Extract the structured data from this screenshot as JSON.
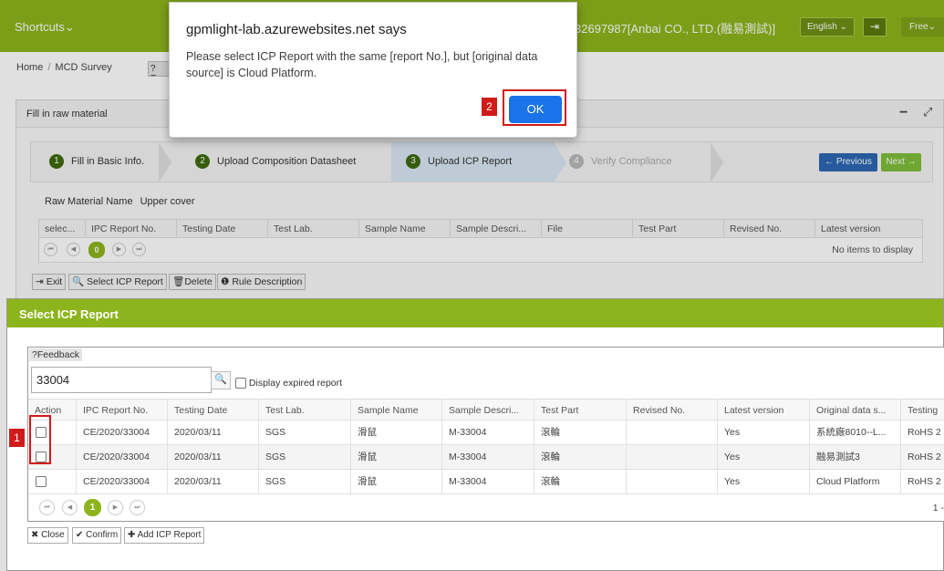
{
  "topbar": {
    "shortcuts": "Shortcuts",
    "shortcuts_chevron": "⌄",
    "company": "32697987[Anbai CO., LTD.(融易測試)]",
    "language": "English ⌄",
    "logout_icon": "⇥",
    "free": "Free⌄"
  },
  "breadcrumb": {
    "home": "Home",
    "sep": "/",
    "current": "MCD Survey",
    "feedback": "?Feedback"
  },
  "panel": {
    "title": "Fill in raw material",
    "minimize": "−",
    "expand": "⤢",
    "steps": [
      {
        "num": "1",
        "label": "Fill in Basic Info."
      },
      {
        "num": "2",
        "label": "Upload Composition Datasheet"
      },
      {
        "num": "3",
        "label": "Upload ICP Report"
      },
      {
        "num": "4",
        "label": "Verify Compliance"
      }
    ],
    "previous": "← Previous",
    "next": "Next →",
    "raw_material_label": "Raw Material Name",
    "raw_material_value": "Upper cover",
    "columns": [
      "selec...",
      "IPC Report No.",
      "Testing Date",
      "Test Lab.",
      "Sample Name",
      "Sample Descri...",
      "File",
      "Test Part",
      "Revised No.",
      "Latest version"
    ],
    "pager": {
      "first": "⏮",
      "prev": "◀",
      "page": "0",
      "next": "▶",
      "last": "⏭"
    },
    "no_items": "No items to display",
    "toolbar": {
      "exit": "⇥ Exit",
      "select": "🔍 Select ICP Report",
      "delete": "🗑Delete",
      "rule": "❶ Rule Description"
    }
  },
  "modal": {
    "title": "Select ICP Report",
    "feedback": "?Feedback",
    "search_value": "33004",
    "search_icon": "🔍",
    "expired_label": "Display expired report",
    "columns": [
      "Action",
      "IPC Report No.",
      "Testing Date",
      "Test Lab.",
      "Sample Name",
      "Sample Descri...",
      "Test Part",
      "Revised No.",
      "Latest version",
      "Original data s...",
      "Testing"
    ],
    "rows": [
      {
        "report": "CE/2020/33004",
        "date": "2020/03/11",
        "lab": "SGS",
        "sample": "滑鼠",
        "desc": "M-33004",
        "part": "滾輪",
        "revised": "",
        "latest": "Yes",
        "source": "系統廠8010--L...",
        "testing": "RoHS 2"
      },
      {
        "report": "CE/2020/33004",
        "date": "2020/03/11",
        "lab": "SGS",
        "sample": "滑鼠",
        "desc": "M-33004",
        "part": "滾輪",
        "revised": "",
        "latest": "Yes",
        "source": "融易測試3",
        "testing": "RoHS 2"
      },
      {
        "report": "CE/2020/33004",
        "date": "2020/03/11",
        "lab": "SGS",
        "sample": "滑鼠",
        "desc": "M-33004",
        "part": "滾輪",
        "revised": "",
        "latest": "Yes",
        "source": "Cloud Platform",
        "testing": "RoHS 2"
      }
    ],
    "pager": {
      "first": "⏮",
      "prev": "◀",
      "page": "1",
      "next": "▶",
      "last": "⏭",
      "range": "1 -"
    },
    "buttons": {
      "close": "✖ Close",
      "confirm": "✔ Confirm",
      "add": "✚ Add ICP Report"
    }
  },
  "alert": {
    "title": "gpmlight-lab.azurewebsites.net says",
    "message": "Please select ICP Report with the same [report No.], but [original data source] is Cloud Platform.",
    "ok": "OK"
  },
  "annotations": {
    "badge1": "1",
    "badge2": "2",
    "color": "#d11a1a"
  },
  "colors": {
    "brand_green": "#8cb41c",
    "dialog_blue": "#1a73e8",
    "prev_blue": "#2c67b2"
  }
}
